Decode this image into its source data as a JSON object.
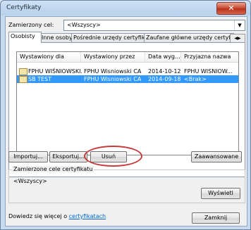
{
  "window": {
    "title": "Certyfikaty",
    "close_glyph": "✕"
  },
  "purpose": {
    "label": "Zamierzony cel:",
    "value": "<Wszyscy>"
  },
  "tabs": [
    {
      "label": "Osobisty"
    },
    {
      "label": "Inne osoby"
    },
    {
      "label": "Pośrednie urzędy certyfikacji"
    },
    {
      "label": "Zaufane główne urzędy certyfikacji"
    }
  ],
  "tab_scroll": "◀▶",
  "columns": [
    "Wystawiony dla",
    "Wystawiony przez",
    "Data wyg...",
    "Przyjazna nazwa"
  ],
  "rows": [
    {
      "issued_to": "FPHU WIŚNIOWSKI...",
      "issued_by": "FPHU Wisniowski CA",
      "expiry": "2014-10-12",
      "friendly": "FPHU WISNIOW..."
    },
    {
      "issued_to": "SB TEST",
      "issued_by": "FPHU Wisniowski CA",
      "expiry": "2014-09-18",
      "friendly": "<Brak>"
    }
  ],
  "buttons": {
    "import": "Importuj...",
    "export": "Eksportuj...",
    "remove": "Usuń",
    "advanced": "Zaawansowane",
    "view": "Wyświetl",
    "close": "Zamknij"
  },
  "group": {
    "title": "Zamierzone cele certyfikatu",
    "value": "<Wszyscy>"
  },
  "footer": {
    "text": "Dowiedz się więcej o ",
    "link": "certyfikatach"
  }
}
